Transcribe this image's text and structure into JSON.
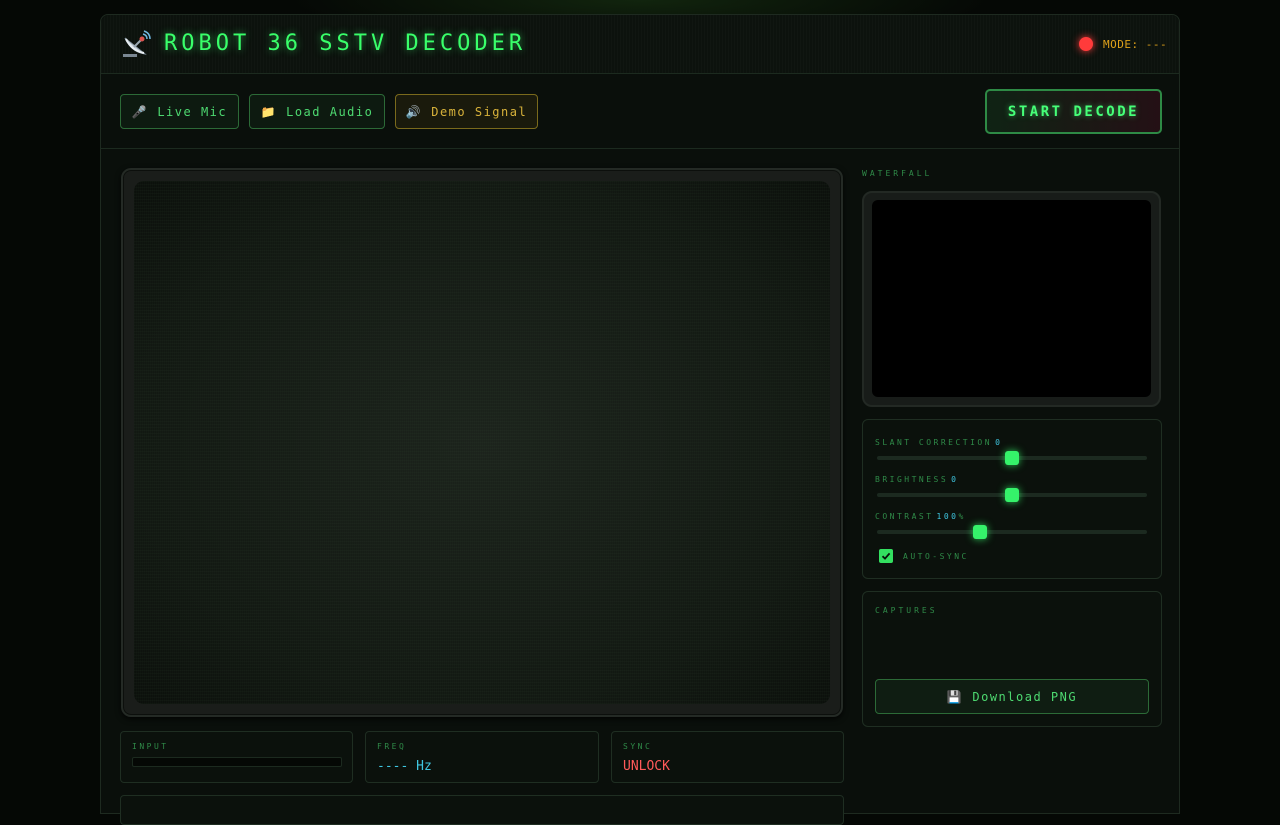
{
  "header": {
    "title": "ROBOT 36 SSTV DECODER",
    "logo_icon": "satellite-antenna-icon",
    "mode_label": "MODE:",
    "mode_value": "---",
    "status_color": "#ff3b3b"
  },
  "toolbar": {
    "live_mic": {
      "icon": "🎤",
      "label": "Live Mic"
    },
    "load_audio": {
      "icon": "📁",
      "label": "Load Audio"
    },
    "demo_signal": {
      "icon": "🔊",
      "label": "Demo Signal"
    },
    "start_label": "START DECODE"
  },
  "stats": {
    "input_label": "INPUT",
    "input_level": 0,
    "freq_label": "FREQ",
    "freq_value": "---- Hz",
    "sync_label": "SYNC",
    "sync_value": "UNLOCK"
  },
  "sidebar": {
    "waterfall_label": "WATERFALL",
    "slant": {
      "label": "SLANT CORRECTION",
      "value": "0"
    },
    "brightness": {
      "label": "BRIGHTNESS",
      "value": "0"
    },
    "contrast": {
      "label": "CONTRAST",
      "value": "100",
      "unit": "%"
    },
    "auto_sync": {
      "label": "AUTO-SYNC",
      "checked": true
    },
    "captures_label": "CAPTURES",
    "download": {
      "icon": "💾",
      "label": "Download PNG"
    }
  },
  "colors": {
    "accent": "#39ff6a",
    "warning": "#e0a21a",
    "error": "#ff5a5a",
    "info": "#3fc6e0"
  }
}
